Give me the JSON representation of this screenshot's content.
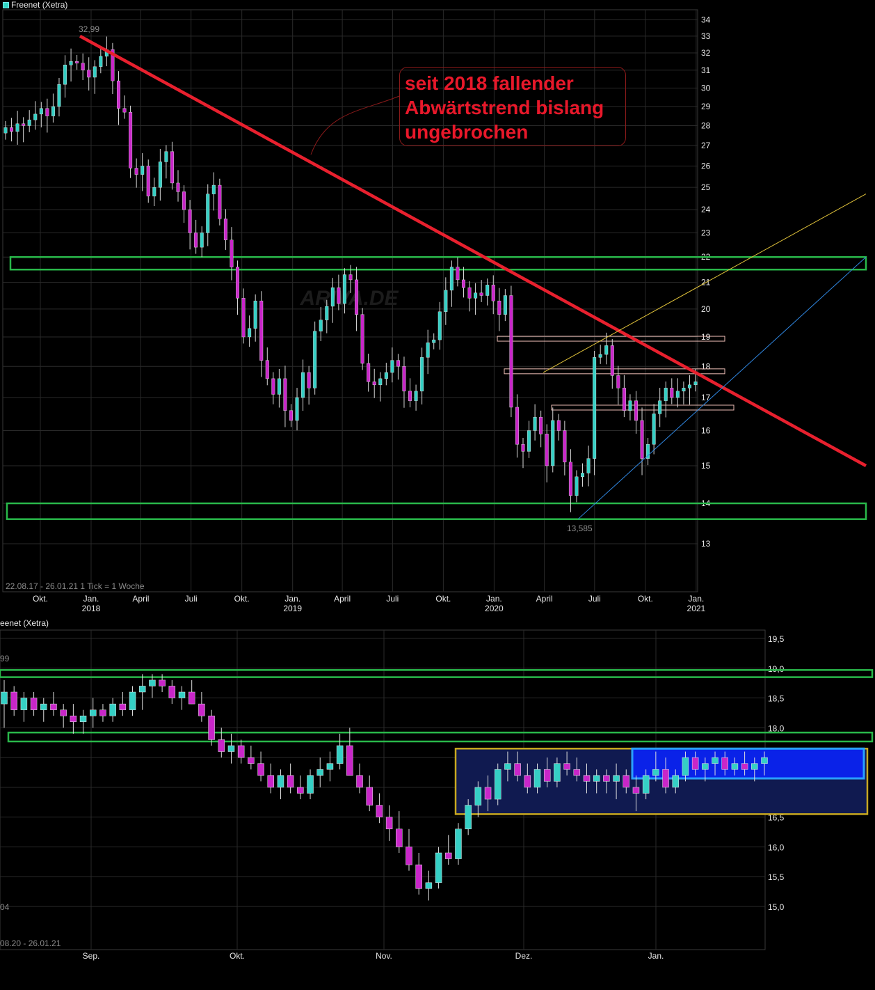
{
  "colors": {
    "background": "#000000",
    "grid": "#2a2a2a",
    "up_candle": "#35d0c5",
    "down_candle": "#c926c9",
    "trendline": "#e8202e",
    "support_zone": "#29b84a",
    "resistance_line": "#f0c0b8",
    "upper_channel": "#e0c23a",
    "lower_channel": "#2f86e0",
    "consolidation_box": "#c8a820",
    "consolidation_fill": "#101a50",
    "recent_range_fill": "#0a22e8",
    "recent_range_border": "#2aa0ff"
  },
  "icons": [
    "legend-square-icon"
  ],
  "annotation": {
    "text": "seit 2018 fallender\nAbwärtstrend bislang\nungebrochen"
  },
  "chart_data": [
    {
      "type": "candlestick",
      "title": "Freenet (Xetra)",
      "range_label": "22.08.17 - 26.01.21",
      "tick_label": "1 Tick = 1 Woche",
      "watermark": "ARIVA.DE",
      "high_label": "32,99",
      "low_label": "13,585",
      "y_ticks": [
        "34",
        "33",
        "32",
        "31",
        "30",
        "29",
        "28",
        "27",
        "26",
        "25",
        "24",
        "23",
        "22",
        "21",
        "20",
        "19",
        "18",
        "17",
        "16",
        "15",
        "14",
        "13"
      ],
      "y_scale": "log",
      "ylim": [
        12.2,
        35.2
      ],
      "x_ticks": [
        {
          "label": "Okt.",
          "year": ""
        },
        {
          "label": "Jan.",
          "year": "2018"
        },
        {
          "label": "April",
          "year": ""
        },
        {
          "label": "Juli",
          "year": ""
        },
        {
          "label": "Okt.",
          "year": ""
        },
        {
          "label": "Jan.",
          "year": "2019"
        },
        {
          "label": "April",
          "year": ""
        },
        {
          "label": "Juli",
          "year": ""
        },
        {
          "label": "Okt.",
          "year": ""
        },
        {
          "label": "Jan.",
          "year": "2020"
        },
        {
          "label": "April",
          "year": ""
        },
        {
          "label": "Juli",
          "year": ""
        },
        {
          "label": "Okt.",
          "year": ""
        },
        {
          "label": "Jan.",
          "year": "2021"
        }
      ],
      "close_series": [
        27.9,
        27.7,
        28.1,
        28.0,
        28.3,
        28.6,
        28.9,
        28.5,
        29.0,
        30.2,
        31.3,
        31.5,
        31.4,
        31.0,
        30.6,
        31.2,
        31.8,
        32.2,
        30.4,
        28.9,
        28.7,
        25.9,
        25.6,
        26.0,
        24.6,
        25.0,
        26.2,
        26.7,
        25.2,
        24.8,
        24.0,
        23.0,
        22.4,
        23.0,
        24.7,
        25.1,
        23.6,
        22.7,
        21.6,
        20.4,
        19.0,
        19.3,
        20.3,
        18.2,
        17.6,
        17.1,
        17.6,
        16.6,
        16.3,
        17.0,
        17.8,
        17.3,
        19.2,
        19.6,
        20.1,
        20.8,
        20.2,
        21.3,
        21.1,
        19.8,
        18.1,
        17.5,
        17.4,
        17.6,
        17.8,
        18.2,
        18.0,
        17.2,
        16.9,
        17.2,
        18.3,
        18.8,
        18.9,
        19.9,
        20.7,
        21.6,
        21.1,
        20.8,
        20.4,
        20.6,
        20.5,
        20.9,
        20.3,
        19.8,
        20.5,
        16.7,
        15.6,
        15.4,
        16.0,
        16.4,
        15.9,
        15.0,
        16.3,
        16.0,
        15.1,
        14.2,
        14.7,
        14.8,
        15.2,
        18.3,
        18.4,
        18.7,
        17.7,
        17.3,
        16.6,
        16.9,
        16.3,
        15.2,
        15.6,
        16.5,
        16.9,
        17.3,
        17.0,
        17.2,
        17.3,
        17.4,
        17.5
      ],
      "trendlines": [
        {
          "name": "Abwärtstrend",
          "from": {
            "date": "2018-01",
            "value": 33.0
          },
          "to": {
            "date": "2021-05",
            "value": 15.0
          }
        },
        {
          "name": "Aufwärtskanal oben",
          "from": {
            "date": "2020-04",
            "value": 17.8
          },
          "to": {
            "date": "2021-06",
            "value": 24.7
          }
        },
        {
          "name": "Aufwärtskanal unten",
          "from": {
            "date": "2020-07",
            "value": 13.6
          },
          "to": {
            "date": "2021-06",
            "value": 22.0
          }
        }
      ],
      "zones": [
        {
          "kind": "support",
          "range": [
            21.5,
            22.0
          ]
        },
        {
          "kind": "support",
          "range": [
            13.6,
            14.0
          ]
        },
        {
          "kind": "resistance",
          "value": 18.95
        },
        {
          "kind": "resistance",
          "value": 17.85
        },
        {
          "kind": "resistance",
          "value": 16.7
        }
      ]
    },
    {
      "type": "candlestick",
      "title": "Freenet (Xetra)",
      "title_visible": "eenet (Xetra)",
      "range_label": "08.20 - 26.01.21",
      "high_label": "99",
      "low_label": "04",
      "y_ticks": [
        "19,5",
        "19,0",
        "18,5",
        "18,0",
        "17,5",
        "17,0",
        "16,5",
        "16,0",
        "15,5",
        "15,0"
      ],
      "ylim": [
        14.4,
        19.7
      ],
      "x_ticks": [
        "Sep.",
        "Okt.",
        "Nov.",
        "Dez.",
        "Jan."
      ],
      "candles": [
        [
          18.4,
          18.8,
          18.0,
          18.6
        ],
        [
          18.6,
          18.7,
          18.2,
          18.3
        ],
        [
          18.3,
          18.6,
          18.1,
          18.5
        ],
        [
          18.5,
          18.6,
          18.2,
          18.3
        ],
        [
          18.3,
          18.5,
          18.1,
          18.4
        ],
        [
          18.4,
          18.6,
          18.2,
          18.3
        ],
        [
          18.3,
          18.4,
          18.0,
          18.2
        ],
        [
          18.2,
          18.4,
          17.9,
          18.1
        ],
        [
          18.1,
          18.3,
          17.9,
          18.2
        ],
        [
          18.2,
          18.5,
          18.0,
          18.3
        ],
        [
          18.3,
          18.4,
          18.1,
          18.2
        ],
        [
          18.2,
          18.5,
          18.1,
          18.4
        ],
        [
          18.4,
          18.6,
          18.2,
          18.3
        ],
        [
          18.3,
          18.7,
          18.2,
          18.6
        ],
        [
          18.6,
          18.9,
          18.3,
          18.7
        ],
        [
          18.7,
          18.9,
          18.5,
          18.8
        ],
        [
          18.8,
          18.9,
          18.6,
          18.7
        ],
        [
          18.7,
          18.8,
          18.4,
          18.5
        ],
        [
          18.5,
          18.7,
          18.3,
          18.6
        ],
        [
          18.6,
          18.8,
          18.4,
          18.4
        ],
        [
          18.4,
          18.6,
          18.1,
          18.2
        ],
        [
          18.2,
          18.3,
          17.7,
          17.8
        ],
        [
          17.8,
          18.0,
          17.5,
          17.6
        ],
        [
          17.6,
          17.9,
          17.4,
          17.7
        ],
        [
          17.7,
          17.8,
          17.4,
          17.5
        ],
        [
          17.5,
          17.7,
          17.3,
          17.4
        ],
        [
          17.4,
          17.6,
          17.1,
          17.2
        ],
        [
          17.2,
          17.4,
          16.9,
          17.0
        ],
        [
          17.0,
          17.3,
          16.8,
          17.2
        ],
        [
          17.2,
          17.4,
          16.9,
          17.0
        ],
        [
          17.0,
          17.2,
          16.8,
          16.9
        ],
        [
          16.9,
          17.3,
          16.8,
          17.2
        ],
        [
          17.2,
          17.5,
          17.0,
          17.3
        ],
        [
          17.3,
          17.6,
          17.1,
          17.4
        ],
        [
          17.4,
          17.9,
          17.3,
          17.7
        ],
        [
          17.7,
          18.0,
          17.2,
          17.2
        ],
        [
          17.2,
          17.4,
          16.9,
          17.0
        ],
        [
          17.0,
          17.2,
          16.6,
          16.7
        ],
        [
          16.7,
          16.9,
          16.4,
          16.5
        ],
        [
          16.5,
          16.7,
          16.1,
          16.3
        ],
        [
          16.3,
          16.6,
          15.9,
          16.0
        ],
        [
          16.0,
          16.3,
          15.6,
          15.7
        ],
        [
          15.7,
          15.9,
          15.2,
          15.3
        ],
        [
          15.3,
          15.6,
          15.1,
          15.4
        ],
        [
          15.4,
          16.0,
          15.3,
          15.9
        ],
        [
          15.9,
          16.2,
          15.7,
          15.8
        ],
        [
          15.8,
          16.4,
          15.7,
          16.3
        ],
        [
          16.3,
          16.8,
          16.2,
          16.7
        ],
        [
          16.7,
          17.1,
          16.5,
          17.0
        ],
        [
          17.0,
          17.2,
          16.6,
          16.8
        ],
        [
          16.8,
          17.4,
          16.7,
          17.3
        ],
        [
          17.3,
          17.6,
          17.1,
          17.4
        ],
        [
          17.4,
          17.6,
          17.1,
          17.2
        ],
        [
          17.2,
          17.4,
          16.9,
          17.0
        ],
        [
          17.0,
          17.4,
          16.9,
          17.3
        ],
        [
          17.3,
          17.5,
          17.0,
          17.1
        ],
        [
          17.1,
          17.5,
          17.0,
          17.4
        ],
        [
          17.4,
          17.6,
          17.2,
          17.3
        ],
        [
          17.3,
          17.5,
          17.1,
          17.2
        ],
        [
          17.2,
          17.4,
          16.9,
          17.1
        ],
        [
          17.1,
          17.3,
          16.9,
          17.2
        ],
        [
          17.2,
          17.3,
          16.9,
          17.1
        ],
        [
          17.1,
          17.4,
          16.8,
          17.2
        ],
        [
          17.2,
          17.3,
          16.9,
          17.0
        ],
        [
          17.0,
          17.2,
          16.6,
          16.9
        ],
        [
          16.9,
          17.3,
          16.8,
          17.2
        ],
        [
          17.2,
          17.6,
          17.1,
          17.3
        ],
        [
          17.3,
          17.5,
          16.9,
          17.0
        ],
        [
          17.0,
          17.3,
          16.9,
          17.2
        ],
        [
          17.2,
          17.6,
          17.1,
          17.5
        ],
        [
          17.5,
          17.6,
          17.2,
          17.3
        ],
        [
          17.3,
          17.5,
          17.1,
          17.4
        ],
        [
          17.4,
          17.6,
          17.2,
          17.5
        ],
        [
          17.5,
          17.6,
          17.2,
          17.3
        ],
        [
          17.3,
          17.5,
          17.2,
          17.4
        ],
        [
          17.4,
          17.6,
          17.2,
          17.3
        ],
        [
          17.3,
          17.5,
          17.1,
          17.4
        ],
        [
          17.4,
          17.6,
          17.2,
          17.5
        ]
      ],
      "zones": [
        {
          "kind": "support",
          "range": [
            18.85,
            18.97
          ]
        },
        {
          "kind": "support",
          "range": [
            17.77,
            17.92
          ]
        },
        {
          "kind": "consolidation",
          "range": [
            16.55,
            17.65
          ]
        },
        {
          "kind": "recent_range",
          "range": [
            17.15,
            17.65
          ]
        }
      ]
    }
  ]
}
